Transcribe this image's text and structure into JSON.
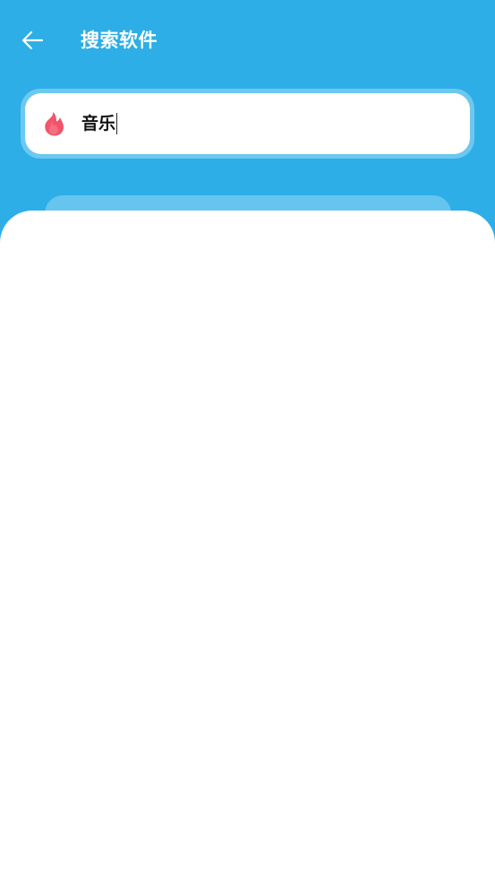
{
  "header": {
    "title": "搜索软件",
    "back_icon": "arrow-left-icon"
  },
  "search": {
    "value": "音乐",
    "leading_icon": "fire-icon",
    "leading_icon_color": "#f2546a"
  },
  "colors": {
    "primary": "#2daee6",
    "surface": "#ffffff"
  }
}
